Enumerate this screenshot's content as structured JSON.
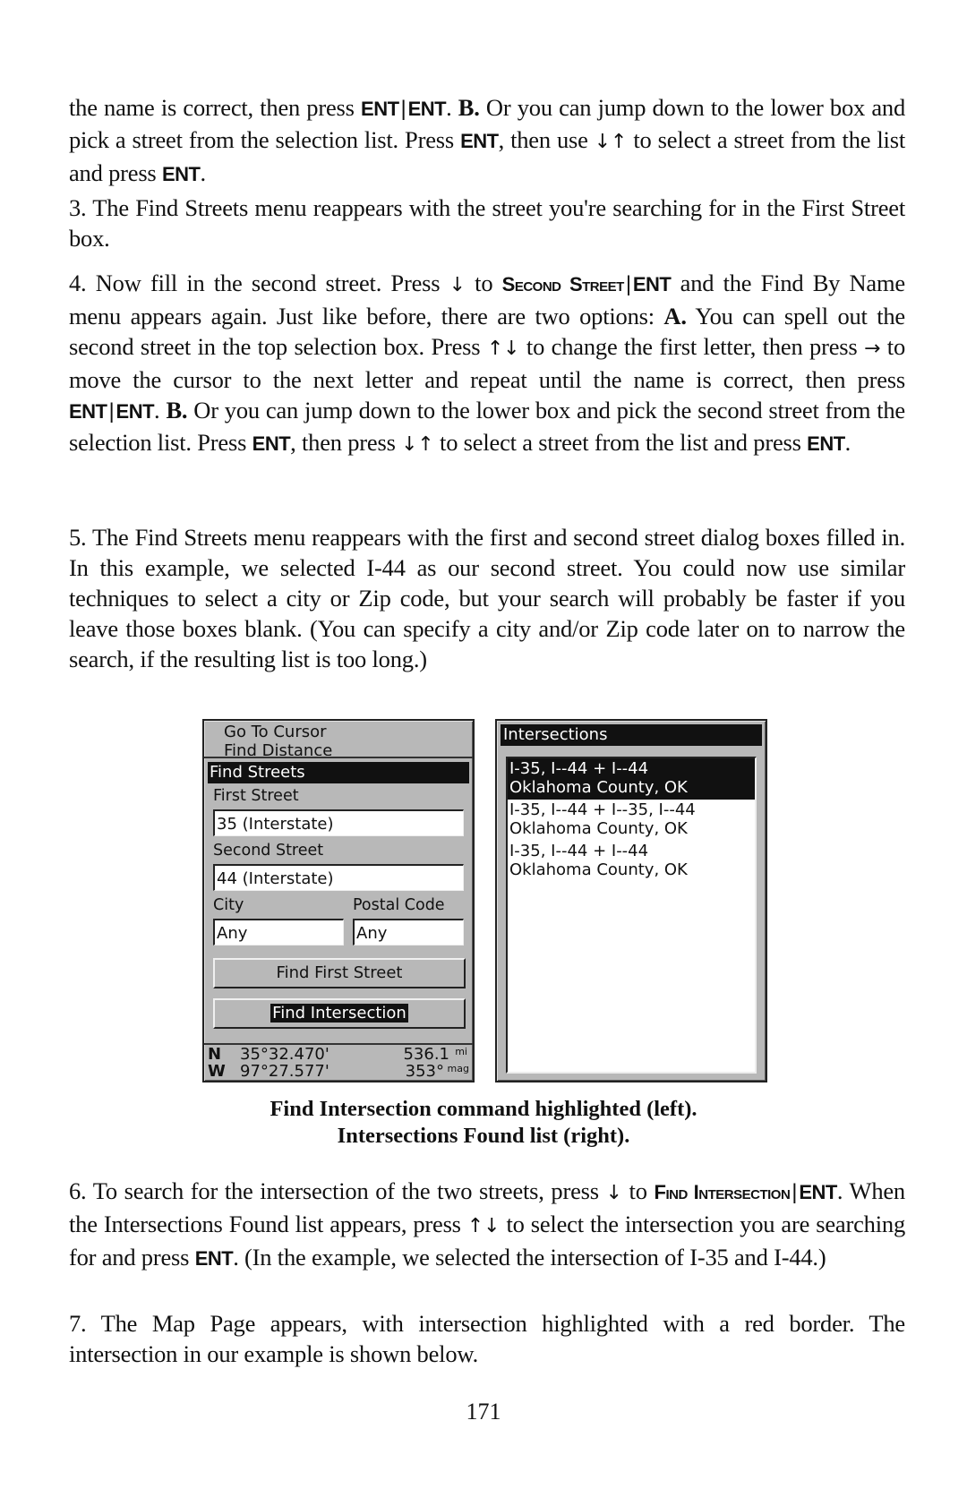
{
  "paragraphs": {
    "p1": {
      "t1": "the name is correct, then press ",
      "k1": "ENT",
      "k2": "ENT",
      "t2": ". ",
      "b1": "B.",
      "t3": " Or you can jump down to the lower box and pick a street from the selection list. Press ",
      "k3": "ENT",
      "t4": ", then use ",
      "arrows": "↓↑",
      "t5": " to select a street from the list and press ",
      "k4": "ENT",
      "t6": "."
    },
    "p3": {
      "text": "3. The Find Streets menu reappears with the street you're searching for in the First Street box."
    },
    "p4": {
      "t1": "4. Now fill in the second street. Press ",
      "a1": "↓",
      "t2": " to ",
      "sc1": "Second Street",
      "k1": "ENT",
      "t3": " and the Find By Name menu appears again. Just like before, there are two options: ",
      "b1": "A.",
      "t4": " You can spell out the second street in the top selection box. Press ",
      "a2": "↑↓",
      "t5": " to change the first letter, then press ",
      "a3": "→",
      "t6": " to move the cursor to the next letter and repeat until the name is correct, then press ",
      "k2": "ENT",
      "k3": "ENT",
      "t7": ". ",
      "b2": "B.",
      "t8": " Or you can jump down to the lower box and pick the second street from the selection list. Press ",
      "k4": "ENT",
      "t9": ", then press ",
      "a4": "↓↑",
      "t10": " to select a street from the list and press ",
      "k5": "ENT",
      "t11": "."
    },
    "p5": {
      "text": "5. The Find Streets menu reappears with the first and second street dialog boxes filled in. In this example, we selected I-44 as our second street. You could now use similar techniques to select a city or Zip code, but your search will probably be faster if you leave those boxes blank. (You can specify a city and/or Zip code later on to narrow the search, if the resulting list is too long.)"
    },
    "p6": {
      "t1": "6. To search for the intersection of the two streets, press ",
      "a1": "↓",
      "t2": " to ",
      "sc1": "Find Intersection",
      "k1": "ENT",
      "t3": ". When the Intersections Found list appears, press ",
      "a2": "↑↓",
      "t4": " to select the intersection you are searching for and press ",
      "k2": "ENT",
      "t5": ". (In the example, we selected the intersection of I-35 and I-44.)"
    },
    "p7": {
      "text": "7. The Map Page appears, with intersection highlighted with a red border. The intersection in our example is shown below."
    }
  },
  "figure": {
    "left_screen": {
      "menu_items": [
        "Go To Cursor",
        "Find Distance"
      ],
      "title": "Find Streets",
      "first_street_label": "First Street",
      "first_street_value": "35 (Interstate)",
      "second_street_label": "Second Street",
      "second_street_value": "44 (Interstate)",
      "city_label": "City",
      "city_value": "Any",
      "postal_label": "Postal Code",
      "postal_value": "Any",
      "find_first_button": "Find First Street",
      "find_intersection_button": "Find Intersection",
      "status": {
        "lat_dir": "N",
        "lat": "35°32.470'",
        "distance": "536.1",
        "distance_unit": "mi",
        "lon_dir": "W",
        "lon": "97°27.577'",
        "bearing": "353°",
        "bearing_unit": "mag"
      }
    },
    "right_screen": {
      "title": "Intersections",
      "items": [
        {
          "line1": "I-35, I--44 + I--44",
          "line2": "Oklahoma County, OK",
          "selected": true
        },
        {
          "line1": "I-35, I--44 + I--35, I--44",
          "line2": "Oklahoma County, OK",
          "selected": false
        },
        {
          "line1": "I-35, I--44 + I--44",
          "line2": "Oklahoma County, OK",
          "selected": false
        }
      ]
    },
    "caption_line1": "Find Intersection command highlighted (left).",
    "caption_line2": "Intersections Found list (right)."
  },
  "page_number": "171"
}
